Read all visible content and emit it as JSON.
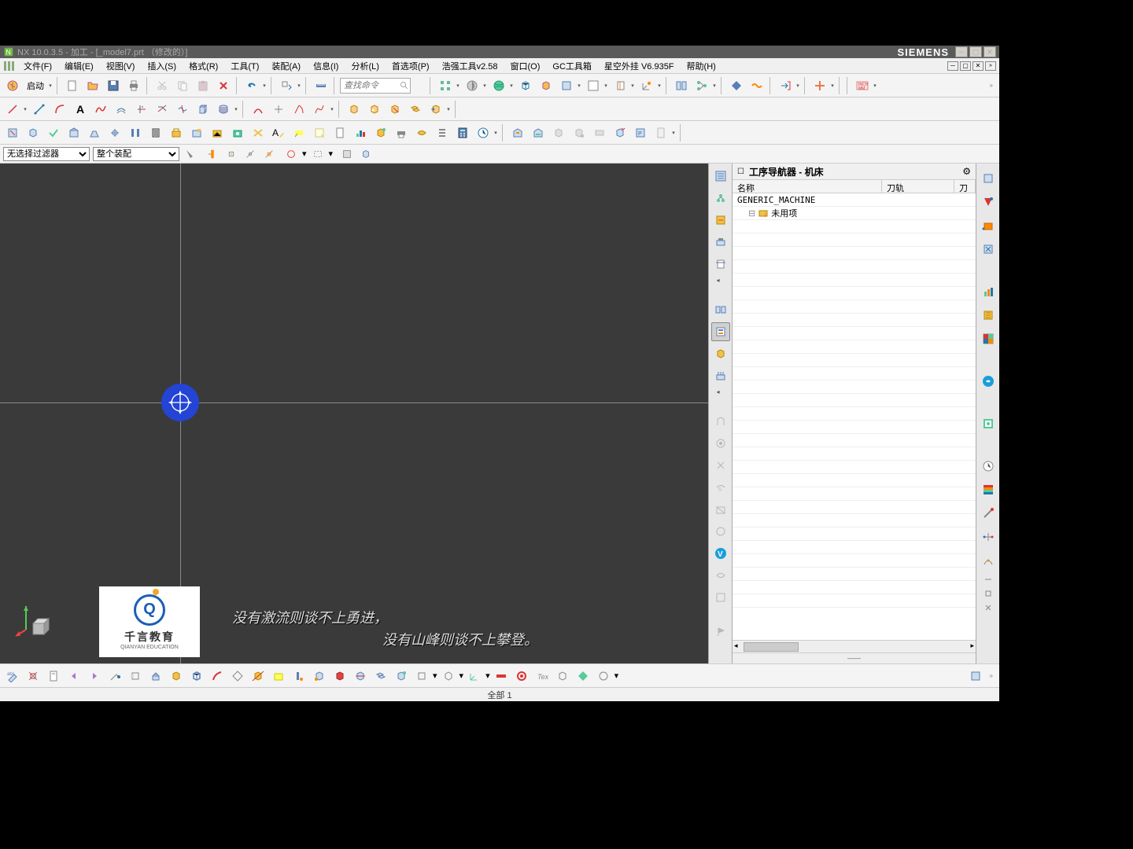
{
  "title_bar": {
    "app_title": "NX 10.0.3.5 - 加工 - [_model7.prt （修改的）]",
    "brand": "SIEMENS"
  },
  "menu_bar": {
    "items": [
      "文件(F)",
      "编辑(E)",
      "视图(V)",
      "插入(S)",
      "格式(R)",
      "工具(T)",
      "装配(A)",
      "信息(I)",
      "分析(L)",
      "首选项(P)",
      "浩强工具v2.58",
      "窗口(O)",
      "GC工具箱",
      "星空外挂 V6.935F",
      "帮助(H)"
    ]
  },
  "toolbar1": {
    "start_label": "启动",
    "search_placeholder": "查找命令"
  },
  "filter_bar": {
    "filter1": "无选择过滤器",
    "filter2": "整个装配"
  },
  "navigator": {
    "title": "工序导航器 - 机床",
    "col_name": "名称",
    "col_path": "刀轨",
    "col_extra": "刀",
    "root_item": "GENERIC_MACHINE",
    "child_item": "未用项"
  },
  "overlay": {
    "line1": "没有激流则谈不上勇进，",
    "line2": "没有山峰则谈不上攀登。"
  },
  "watermark": {
    "brand_cn": "千言教育",
    "brand_en": "QIANYAN EDUCATION"
  },
  "status_bar": {
    "text": "全部 1"
  }
}
